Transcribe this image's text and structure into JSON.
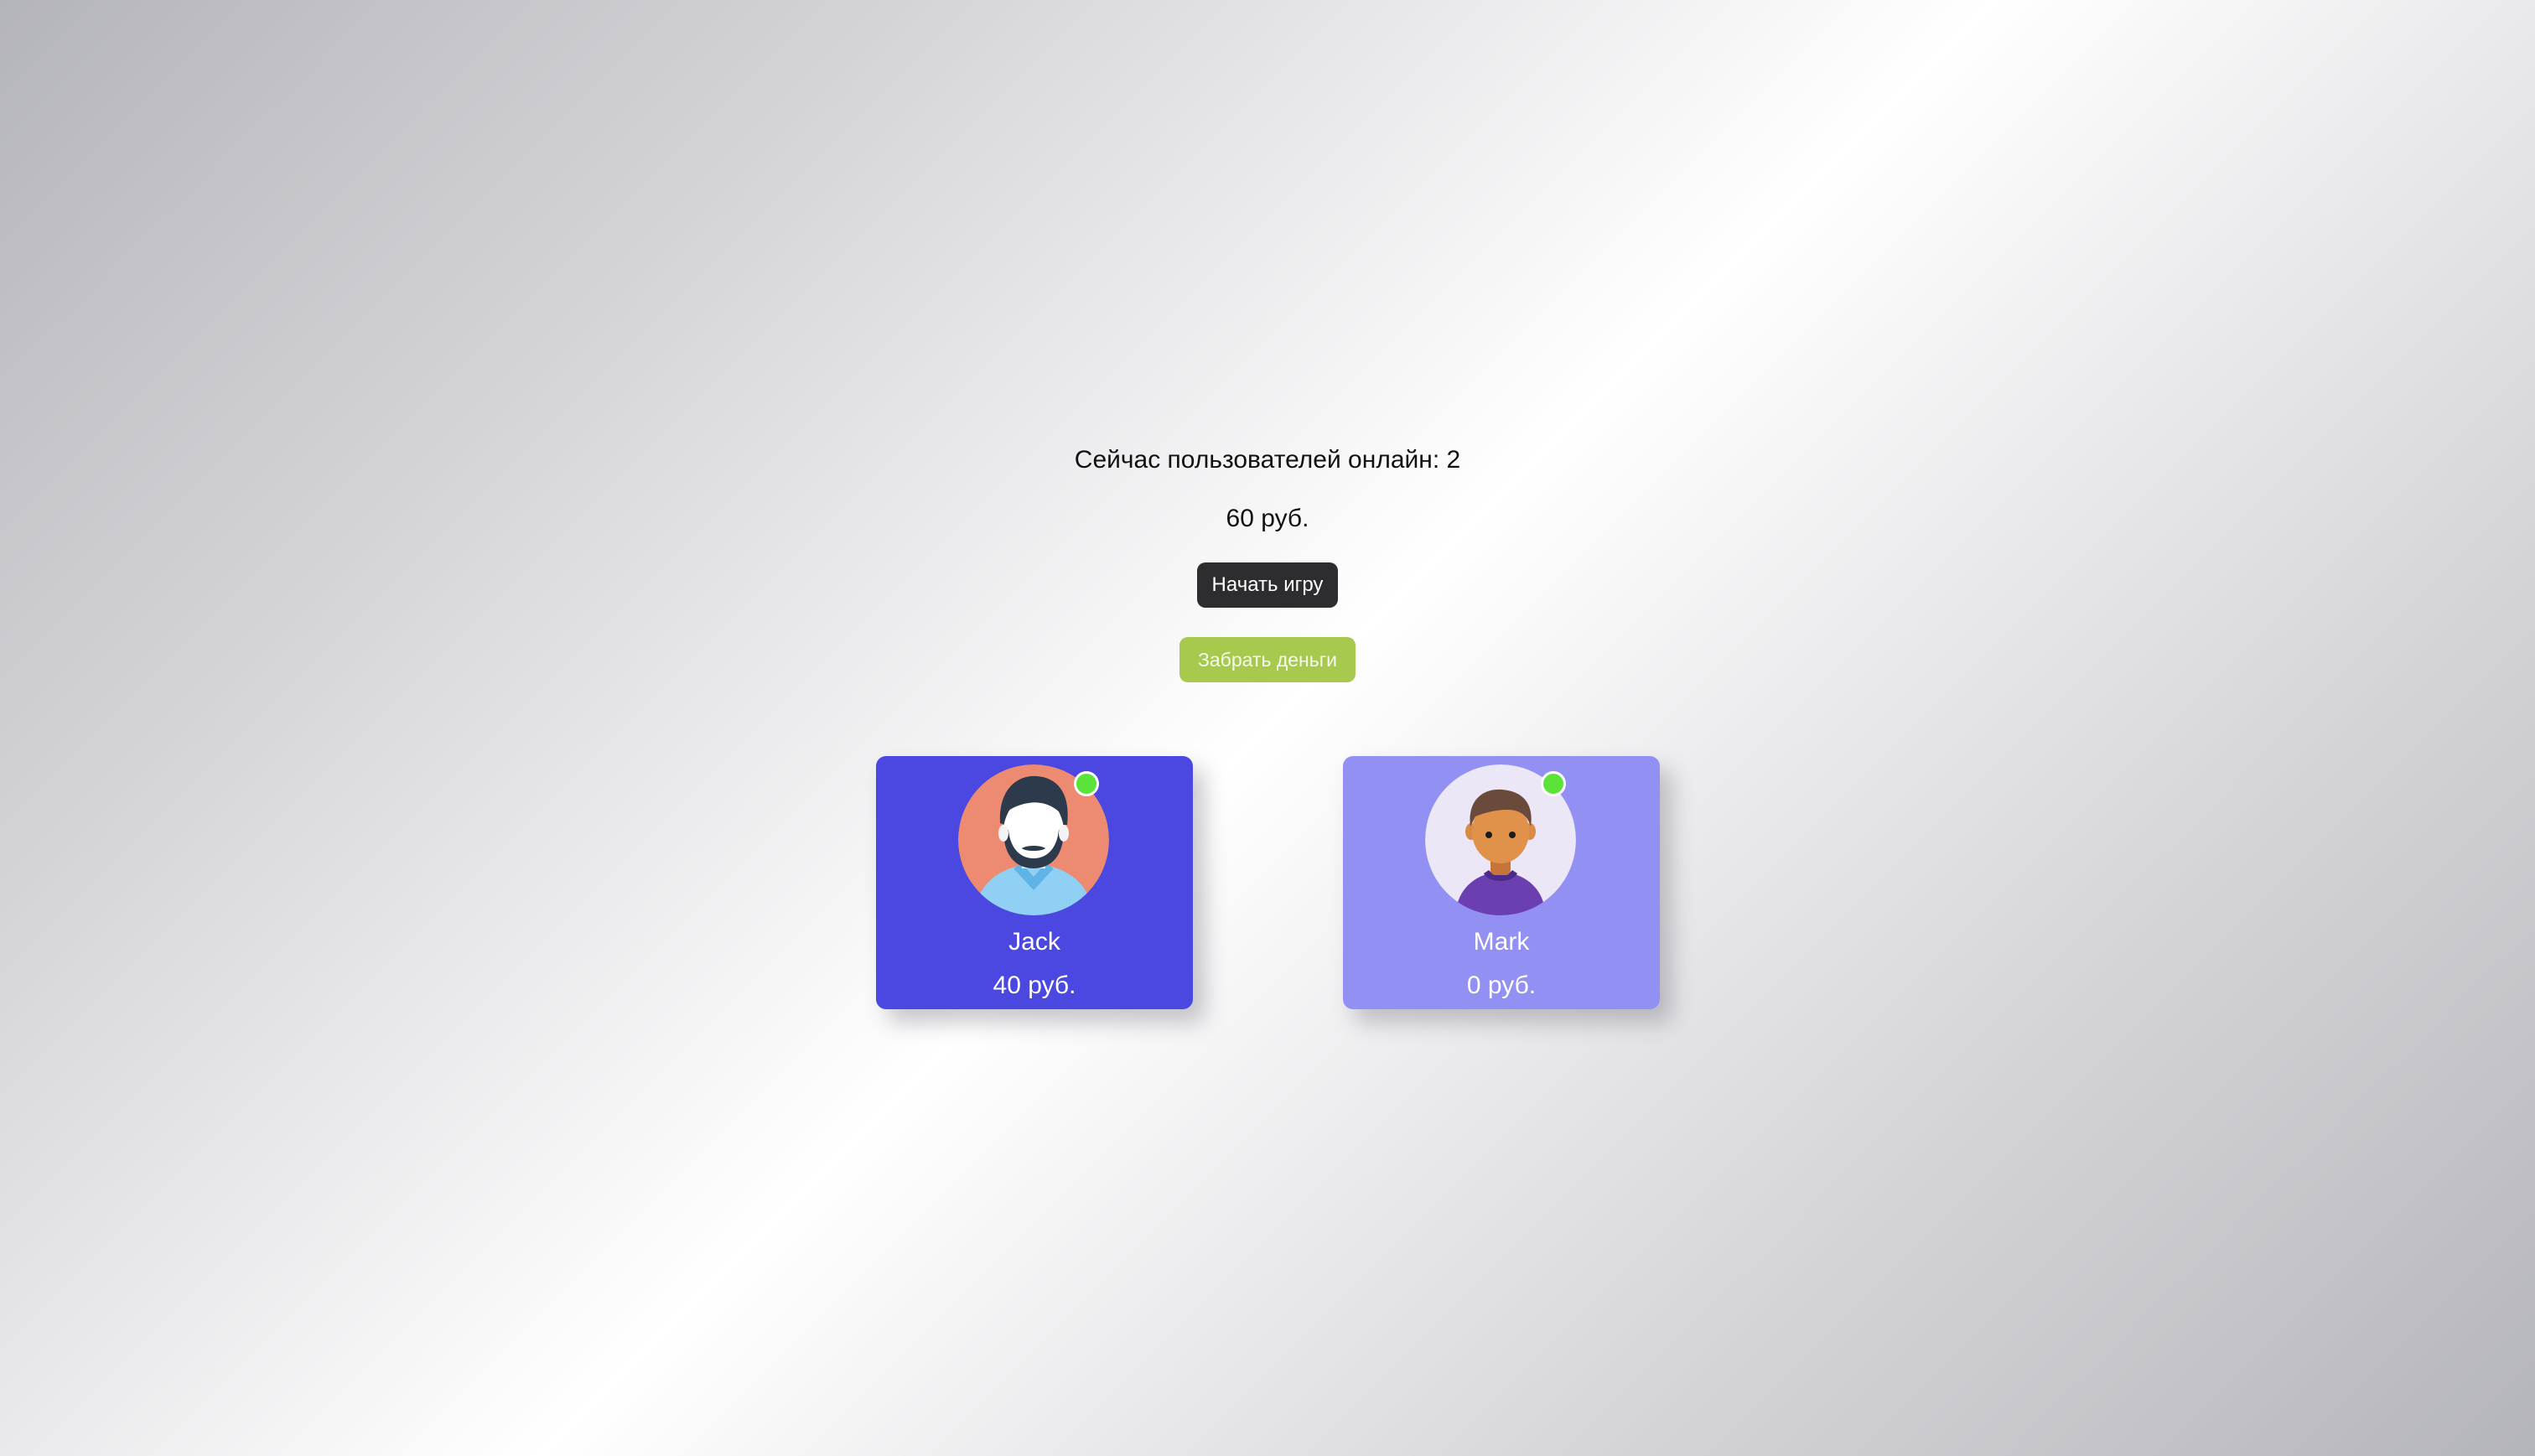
{
  "status": {
    "online_text": "Сейчас пользователей онлайн: 2",
    "total_amount": "60 руб."
  },
  "actions": {
    "start_label": "Начать игру",
    "take_label": "Забрать деньги"
  },
  "colors": {
    "start_button": "#2d2d2f",
    "take_button": "#a6c94e",
    "online_indicator": "#5ce33a",
    "card_active": "#4a48e0",
    "card_inactive": "#9290f3"
  },
  "players": [
    {
      "name": "Jack",
      "amount": "40 руб.",
      "avatar_icon": "bearded-man-avatar-icon",
      "online": true
    },
    {
      "name": "Mark",
      "amount": "0 руб.",
      "avatar_icon": "young-man-avatar-icon",
      "online": true
    }
  ]
}
